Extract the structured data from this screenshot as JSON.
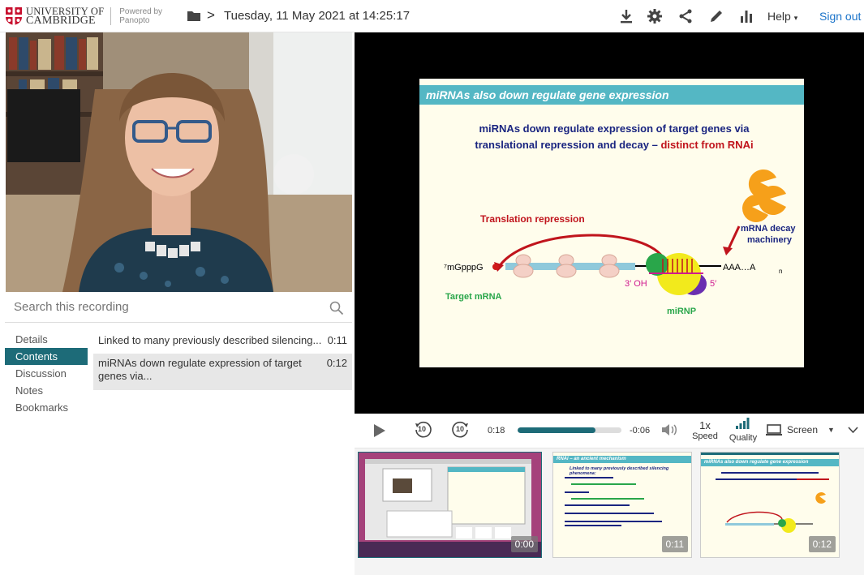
{
  "header": {
    "university_line1": "UNIVERSITY OF",
    "university_line2": "CAMBRIDGE",
    "powered_line1": "Powered by",
    "powered_line2": "Panopto",
    "recording_title": "Tuesday, 11 May 2021 at 14:25:17",
    "help_label": "Help",
    "signout_label": "Sign out",
    "icons": [
      "download-icon",
      "gear-icon",
      "share-icon",
      "edit-icon",
      "stats-icon"
    ]
  },
  "search": {
    "placeholder": "Search this recording"
  },
  "tabs": [
    {
      "label": "Details",
      "active": false
    },
    {
      "label": "Contents",
      "active": true
    },
    {
      "label": "Discussion",
      "active": false
    },
    {
      "label": "Notes",
      "active": false
    },
    {
      "label": "Bookmarks",
      "active": false
    }
  ],
  "contents": [
    {
      "title": "Linked to many previously described silencing...",
      "time": "0:11",
      "selected": false
    },
    {
      "title": "miRNAs down regulate expression of target genes via...",
      "time": "0:12",
      "selected": true
    }
  ],
  "slide": {
    "heading": "miRNAs also down regulate gene expression",
    "subtitle_line1": "miRNAs down regulate expression of target genes via",
    "subtitle_line2": "translational repression and decay – ",
    "subtitle_red": "distinct from RNAi",
    "translation_repression": "Translation repression",
    "cap_label": "⁷mGpppG",
    "target_mrna": "Target mRNA",
    "decay_line1": "mRNA decay",
    "decay_line2": "machinery",
    "polya": "AAA…A",
    "polya_sub": "n",
    "three_oh": "3′ OH",
    "five_prime": "5′",
    "mirnp": "miRNP"
  },
  "controls": {
    "elapsed": "0:18",
    "remaining": "-0:06",
    "progress_fraction": 0.75,
    "speed_value": "1x",
    "speed_label": "Speed",
    "quality_label": "Quality",
    "screen_label": "Screen",
    "skip_back_seconds": "10",
    "skip_forward_seconds": "10"
  },
  "thumbnails": [
    {
      "time": "0:00"
    },
    {
      "time": "0:11",
      "title": "RNAi – an ancient mechanism",
      "heading": "Linked to many previously described silencing phenomena:"
    },
    {
      "time": "0:12",
      "title": "miRNAs also down regulate gene expression"
    }
  ],
  "colors": {
    "accent": "#1d6b78",
    "signout": "#1a73c9",
    "slide_header": "#54b7c4",
    "slide_text": "#1a2580",
    "slide_red": "#c0141c"
  }
}
